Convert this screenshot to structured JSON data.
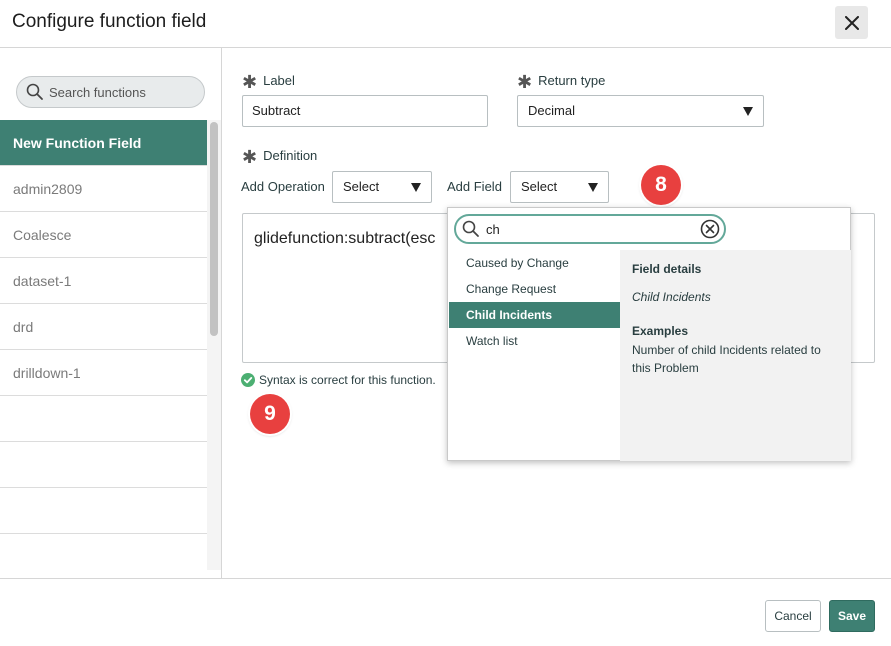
{
  "dialog": {
    "title": "Configure function field"
  },
  "sidebar": {
    "search_placeholder": "Search functions",
    "items": [
      {
        "label": "New Function Field"
      },
      {
        "label": "admin2809"
      },
      {
        "label": "Coalesce"
      },
      {
        "label": "dataset-1"
      },
      {
        "label": "drd"
      },
      {
        "label": "drilldown-1"
      }
    ]
  },
  "form": {
    "label_label": "Label",
    "label_value": "Subtract",
    "return_type_label": "Return type",
    "return_type_value": "Decimal",
    "definition_label": "Definition",
    "add_operation_label": "Add Operation",
    "add_operation_value": "Select",
    "add_field_label": "Add Field",
    "add_field_value": "Select",
    "editor_text": "glidefunction:subtract(esc",
    "syntax_message": "Syntax is correct for this function."
  },
  "field_picker": {
    "search_value": "ch",
    "items": [
      {
        "label": "Caused by Change"
      },
      {
        "label": "Change Request"
      },
      {
        "label": "Child Incidents"
      },
      {
        "label": "Watch list"
      }
    ],
    "selected_index": 2,
    "details_heading": "Field details",
    "details_field": "Child Incidents",
    "examples_heading": "Examples",
    "examples_text": "Number of child Incidents related to this Problem"
  },
  "callouts": {
    "step_8": "8",
    "step_9": "9"
  },
  "footer": {
    "cancel_label": "Cancel",
    "save_label": "Save"
  },
  "colors": {
    "accent": "#3e8073",
    "callout": "#e8403f",
    "success": "#4caf72"
  },
  "icons": [
    "close-icon",
    "search-icon",
    "clear-icon",
    "check-circle-icon",
    "caret-down-icon",
    "required-asterisk-icon"
  ]
}
